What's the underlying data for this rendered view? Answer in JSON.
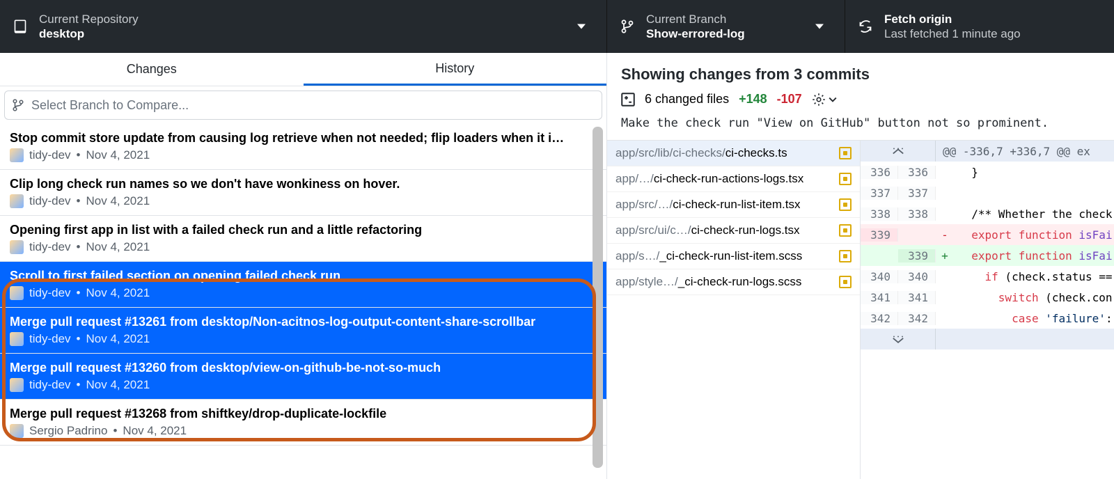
{
  "topbar": {
    "repo_label": "Current Repository",
    "repo_value": "desktop",
    "branch_label": "Current Branch",
    "branch_value": "Show-errored-log",
    "fetch_label": "Fetch origin",
    "fetch_value": "Last fetched 1 minute ago"
  },
  "tabs": {
    "changes": "Changes",
    "history": "History"
  },
  "compare": {
    "placeholder": "Select Branch to Compare..."
  },
  "commits": [
    {
      "title": "Stop commit store update from causing log retrieve when not needed; flip loaders when it i…",
      "author": "tidy-dev",
      "date": "Nov 4, 2021",
      "selected": false
    },
    {
      "title": "Clip long check run names so we don't have wonkiness on hover.",
      "author": "tidy-dev",
      "date": "Nov 4, 2021",
      "selected": false
    },
    {
      "title": "Opening first app in list with a failed check run and a little refactoring",
      "author": "tidy-dev",
      "date": "Nov 4, 2021",
      "selected": false
    },
    {
      "title": "Scroll to first failed section on opening failed check run",
      "author": "tidy-dev",
      "date": "Nov 4, 2021",
      "selected": true
    },
    {
      "title": "Merge pull request #13261 from desktop/Non-acitnos-log-output-content-share-scrollbar",
      "author": "tidy-dev",
      "date": "Nov 4, 2021",
      "selected": true
    },
    {
      "title": "Merge pull request #13260 from desktop/view-on-github-be-not-so-much",
      "author": "tidy-dev",
      "date": "Nov 4, 2021",
      "selected": true
    },
    {
      "title": "Merge pull request #13268 from shiftkey/drop-duplicate-lockfile",
      "author": "Sergio Padrino",
      "date": "Nov 4, 2021",
      "selected": false
    }
  ],
  "diff": {
    "heading": "Showing changes from 3 commits",
    "changed_files": "6 changed files",
    "additions": "+148",
    "deletions": "-107",
    "commit_message": "Make the check run \"View on GitHub\" button not so prominent.",
    "files": [
      {
        "dim": "app/src/lib/ci-checks/",
        "name": "ci-checks.ts",
        "active": true
      },
      {
        "dim": "app/…/",
        "name": "ci-check-run-actions-logs.tsx",
        "active": false
      },
      {
        "dim": "app/src/…/",
        "name": "ci-check-run-list-item.tsx",
        "active": false
      },
      {
        "dim": "app/src/ui/c…/",
        "name": "ci-check-run-logs.tsx",
        "active": false
      },
      {
        "dim": "app/s…/",
        "name": "_ci-check-run-list-item.scss",
        "active": false
      },
      {
        "dim": "app/style…/",
        "name": "_ci-check-run-logs.scss",
        "active": false
      }
    ],
    "hunk_header": "@@ -336,7 +336,7 @@ ex",
    "lines": [
      {
        "old": "336",
        "new": "336",
        "type": "ctx",
        "g": " ",
        "text": "  }"
      },
      {
        "old": "337",
        "new": "337",
        "type": "ctx",
        "g": " ",
        "text": ""
      },
      {
        "old": "338",
        "new": "338",
        "type": "ctx",
        "g": " ",
        "text": "  /** Whether the check"
      },
      {
        "old": "339",
        "new": "",
        "type": "del",
        "g": "-",
        "text": "  export function isFai"
      },
      {
        "old": "",
        "new": "339",
        "type": "add",
        "g": "+",
        "text": "  export function isFai"
      },
      {
        "old": "340",
        "new": "340",
        "type": "ctx",
        "g": " ",
        "text": "    if (check.status =="
      },
      {
        "old": "341",
        "new": "341",
        "type": "ctx",
        "g": " ",
        "text": "      switch (check.con"
      },
      {
        "old": "342",
        "new": "342",
        "type": "ctx",
        "g": " ",
        "text": "        case 'failure':"
      }
    ]
  }
}
